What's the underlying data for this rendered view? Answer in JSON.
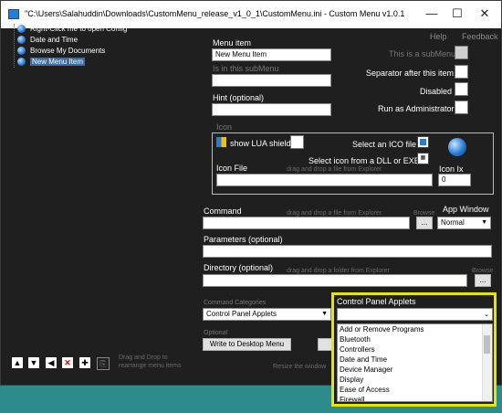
{
  "window": {
    "title": "\"C:\\Users\\Salahuddin\\Downloads\\CustomMenu_release_v1_0_1\\CustomMenu.ini - Custom Menu v1.0.1",
    "minimize": "—",
    "maximize": "☐",
    "close": "✕"
  },
  "menu": {
    "help": "Help",
    "feedback": "Feedback"
  },
  "tree": {
    "items": [
      {
        "label": "Right-Click me to open Config"
      },
      {
        "label": "Date and Time"
      },
      {
        "label": "Browse My Documents"
      },
      {
        "label": "New Menu Item"
      }
    ]
  },
  "form": {
    "menu_item_label": "Menu item",
    "menu_item_value": "New Menu Item",
    "is_in_submenu_label": "Is in this subMenu",
    "hint_label": "Hint (optional)",
    "this_is_submenu_label": "This is a subMenu",
    "separator_label": "Separator after this item",
    "disabled_label": "Disabled",
    "run_as_admin_label": "Run as Administrator",
    "icon_group_label": "Icon",
    "show_lua_label": "show LUA shield",
    "select_ico_label": "Select an ICO file",
    "select_dll_label": "Select icon from a DLL or EXE",
    "icon_file_label": "Icon File",
    "icon_file_hint": "drag and drop a file from Explorer",
    "icon_ix_label": "Icon Ix",
    "icon_ix_value": "0",
    "command_label": "Command",
    "command_hint": "drag and drop a file from Explorer",
    "browse_label": "Browse",
    "browse_button": "...",
    "app_window_label": "App Window",
    "app_window_value": "Normal",
    "parameters_label": "Parameters (optional)",
    "directory_label": "Directory (optional)",
    "directory_hint": "drag and drop a folder from Explorer",
    "browse2_label": "Browse",
    "browse2_button": "...",
    "command_categories_label": "Command Categories",
    "category_value": "Control Panel Applets",
    "optional_label": "Optional",
    "write_desktop_button": "Write to Desktop Menu",
    "drag_drop_hint": "Drag and Drop to\nrearrange menu items",
    "resize_hint": "Resize the window"
  },
  "popup": {
    "title": "Control Panel Applets",
    "items": [
      "Add or Remove Programs",
      "Bluetooth",
      "Controllers",
      "Date and Time",
      "Device Manager",
      "Display",
      "Ease of Access",
      "Firewall"
    ]
  },
  "colors": {
    "highlight": "#e6e600",
    "desktop": "#2e8b8b",
    "window_bg": "#1f1f1f"
  }
}
